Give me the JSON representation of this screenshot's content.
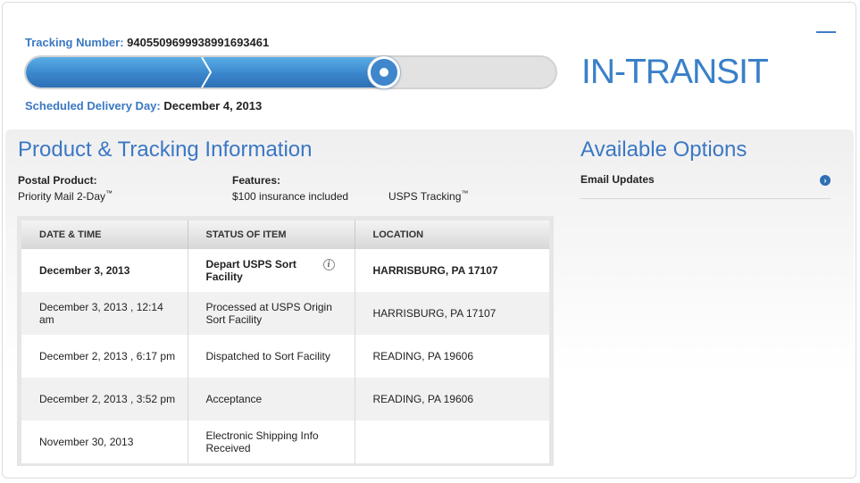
{
  "tracking": {
    "number_label": "Tracking Number:",
    "number": "9405509699938991693461",
    "delivery_label": "Scheduled Delivery Day:",
    "delivery_date": "December 4, 2013",
    "status": "IN-TRANSIT",
    "progress_fraction": 0.68
  },
  "product": {
    "title": "Product & Tracking Information",
    "postal_product_label": "Postal Product:",
    "postal_product": "Priority Mail 2-Day",
    "postal_product_tm": "™",
    "features_label": "Features:",
    "feature_1": "$100 insurance included",
    "feature_2": "USPS Tracking",
    "feature_2_tm": "™"
  },
  "options": {
    "title": "Available Options",
    "items": [
      {
        "label": "Email Updates",
        "icon": "chevron-right-circle-icon"
      }
    ]
  },
  "table": {
    "headers": [
      "DATE & TIME",
      "STATUS OF ITEM",
      "LOCATION"
    ],
    "rows": [
      {
        "date": "December 3, 2013",
        "status": "Depart USPS Sort Facility",
        "location": "HARRISBURG, PA 17107"
      },
      {
        "date": "December 3, 2013 , 12:14 am",
        "status": "Processed at USPS Origin Sort Facility",
        "location": "HARRISBURG, PA 17107"
      },
      {
        "date": "December 2, 2013 , 6:17 pm",
        "status": "Dispatched to Sort Facility",
        "location": "READING, PA 19606"
      },
      {
        "date": "December 2, 2013 , 3:52 pm",
        "status": "Acceptance",
        "location": "READING, PA 19606"
      },
      {
        "date": "November 30, 2013",
        "status": "Electronic Shipping Info Received",
        "location": ""
      }
    ]
  },
  "colors": {
    "accent": "#3a78c3",
    "progress_fill": "#3a86cc",
    "track": "#e2e2e2"
  }
}
